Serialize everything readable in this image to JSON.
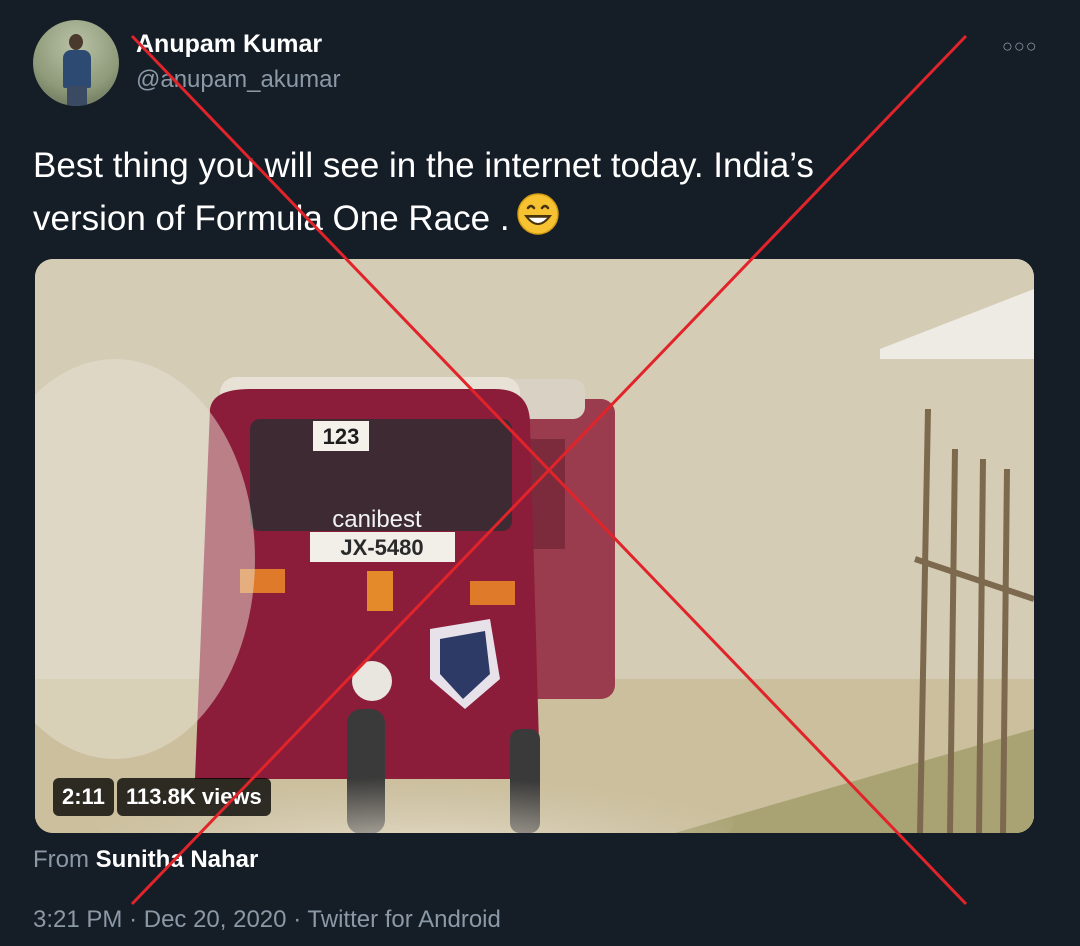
{
  "author": {
    "display_name": "Anupam Kumar",
    "handle": "@anupam_akumar"
  },
  "tweet": {
    "text_line1": "Best thing you will see in the internet today.  India’s",
    "text_line2": "version of Formula One Race ."
  },
  "media": {
    "duration": "2:11",
    "views": "113.8K views",
    "vehicle_number": "123",
    "plate": "JX-5480",
    "windshield_brand": "canibest"
  },
  "from": {
    "prefix": "From",
    "author": "Sunitha Nahar"
  },
  "meta": {
    "time": "3:21 PM",
    "date": "Dec 20, 2020",
    "source": "Twitter for Android",
    "separator": "·"
  },
  "icons": {
    "more": "more-icon",
    "emoji": "grinning-face-emoji"
  },
  "colors": {
    "background": "#151d27",
    "cross": "#e0242a",
    "rickshaw": "#8c1d3a"
  }
}
